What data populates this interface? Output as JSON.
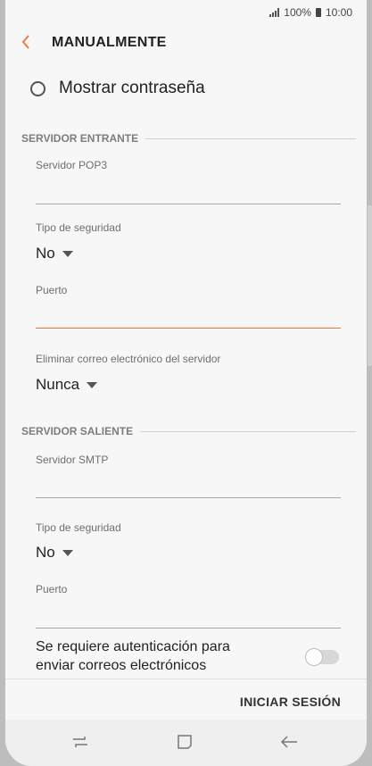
{
  "status": {
    "battery": "100%",
    "time": "10:00"
  },
  "header": {
    "title": "MANUALMENTE"
  },
  "show_password": {
    "label": "Mostrar contraseña"
  },
  "incoming": {
    "title": "SERVIDOR ENTRANTE",
    "server_label": "Servidor POP3",
    "server_value": "",
    "security_label": "Tipo de seguridad",
    "security_value": "No",
    "port_label": "Puerto",
    "port_value": "",
    "delete_label": "Eliminar correo electrónico del servidor",
    "delete_value": "Nunca"
  },
  "outgoing": {
    "title": "SERVIDOR SALIENTE",
    "server_label": "Servidor SMTP",
    "server_value": "",
    "security_label": "Tipo de seguridad",
    "security_value": "No",
    "port_label": "Puerto",
    "port_value": ""
  },
  "auth": {
    "line1": "Se requiere autenticación para",
    "line2": "enviar correos electrónicos",
    "enabled": false
  },
  "footer": {
    "signin": "INICIAR SESIÓN"
  },
  "colors": {
    "accent": "#f0733f",
    "text": "#222222",
    "background": "#f7f7f7"
  },
  "nav": {
    "recents_icon": "recents-icon",
    "home_icon": "home-icon",
    "back_icon": "back-arrow-icon"
  }
}
